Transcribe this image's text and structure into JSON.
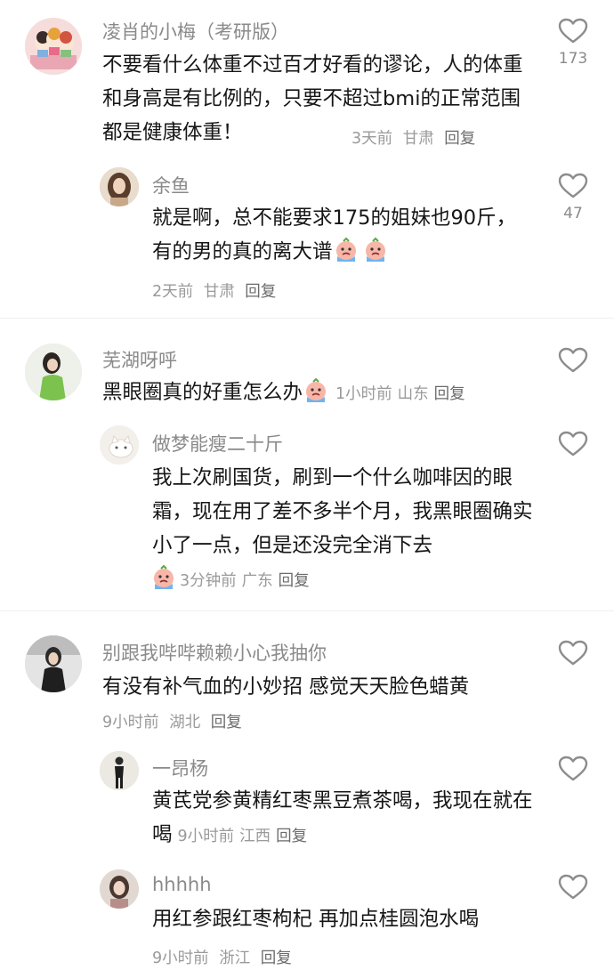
{
  "comments": [
    {
      "user": "凌肖的小梅（考研版）",
      "text": "不要看什么体重不过百才好看的谬论，人的体重和身高是有比例的，只要不超过bmi的正常范围都是健康体重！",
      "time": "3天前",
      "location": "甘肃",
      "reply_label": "回复",
      "likes": "173",
      "avatar_icon": "cartoon-girls-avatar",
      "replies": [
        {
          "user": "余鱼",
          "text": "就是啊，总不能要求175的姐妹也90斤，有的男的真的离大谱",
          "emojis": [
            "crying-emoji",
            "crying-emoji"
          ],
          "time": "2天前",
          "location": "甘肃",
          "reply_label": "回复",
          "likes": "47",
          "avatar_icon": "woman-portrait-avatar"
        }
      ]
    },
    {
      "user": "芜湖呀呼",
      "text": "黑眼圈真的好重怎么办",
      "emojis": [
        "crying-emoji"
      ],
      "time": "1小时前",
      "location": "山东",
      "reply_label": "回复",
      "likes": "",
      "avatar_icon": "woman-green-dress-avatar",
      "replies": [
        {
          "user": "做梦能瘦二十斤",
          "text": "我上次刷国货，刷到一个什么咖啡因的眼霜，现在用了差不多半个月，我黑眼圈确实小了一点，但是还没完全消下去",
          "emojis": [
            "crying-emoji"
          ],
          "time": "3分钟前",
          "location": "广东",
          "reply_label": "回复",
          "likes": "",
          "avatar_icon": "cat-avatar"
        }
      ]
    },
    {
      "user": "别跟我哔哔赖赖小心我抽你",
      "text": "有没有补气血的小妙招 感觉天天脸色蜡黄",
      "time": "9小时前",
      "location": "湖北",
      "reply_label": "回复",
      "likes": "",
      "avatar_icon": "woman-dark-photo-avatar",
      "replies": [
        {
          "user": "一昂杨",
          "text": "黄芪党参黄精红枣黑豆煮茶喝，我现在就在喝",
          "time": "9小时前",
          "location": "江西",
          "reply_label": "回复",
          "likes": "",
          "avatar_icon": "standing-figure-avatar"
        },
        {
          "user": "hhhhh",
          "text": "用红参跟红枣枸杞 再加点桂圆泡水喝",
          "time": "9小时前",
          "location": "浙江",
          "reply_label": "回复",
          "likes": "",
          "avatar_icon": "girl-portrait-avatar"
        }
      ]
    }
  ]
}
